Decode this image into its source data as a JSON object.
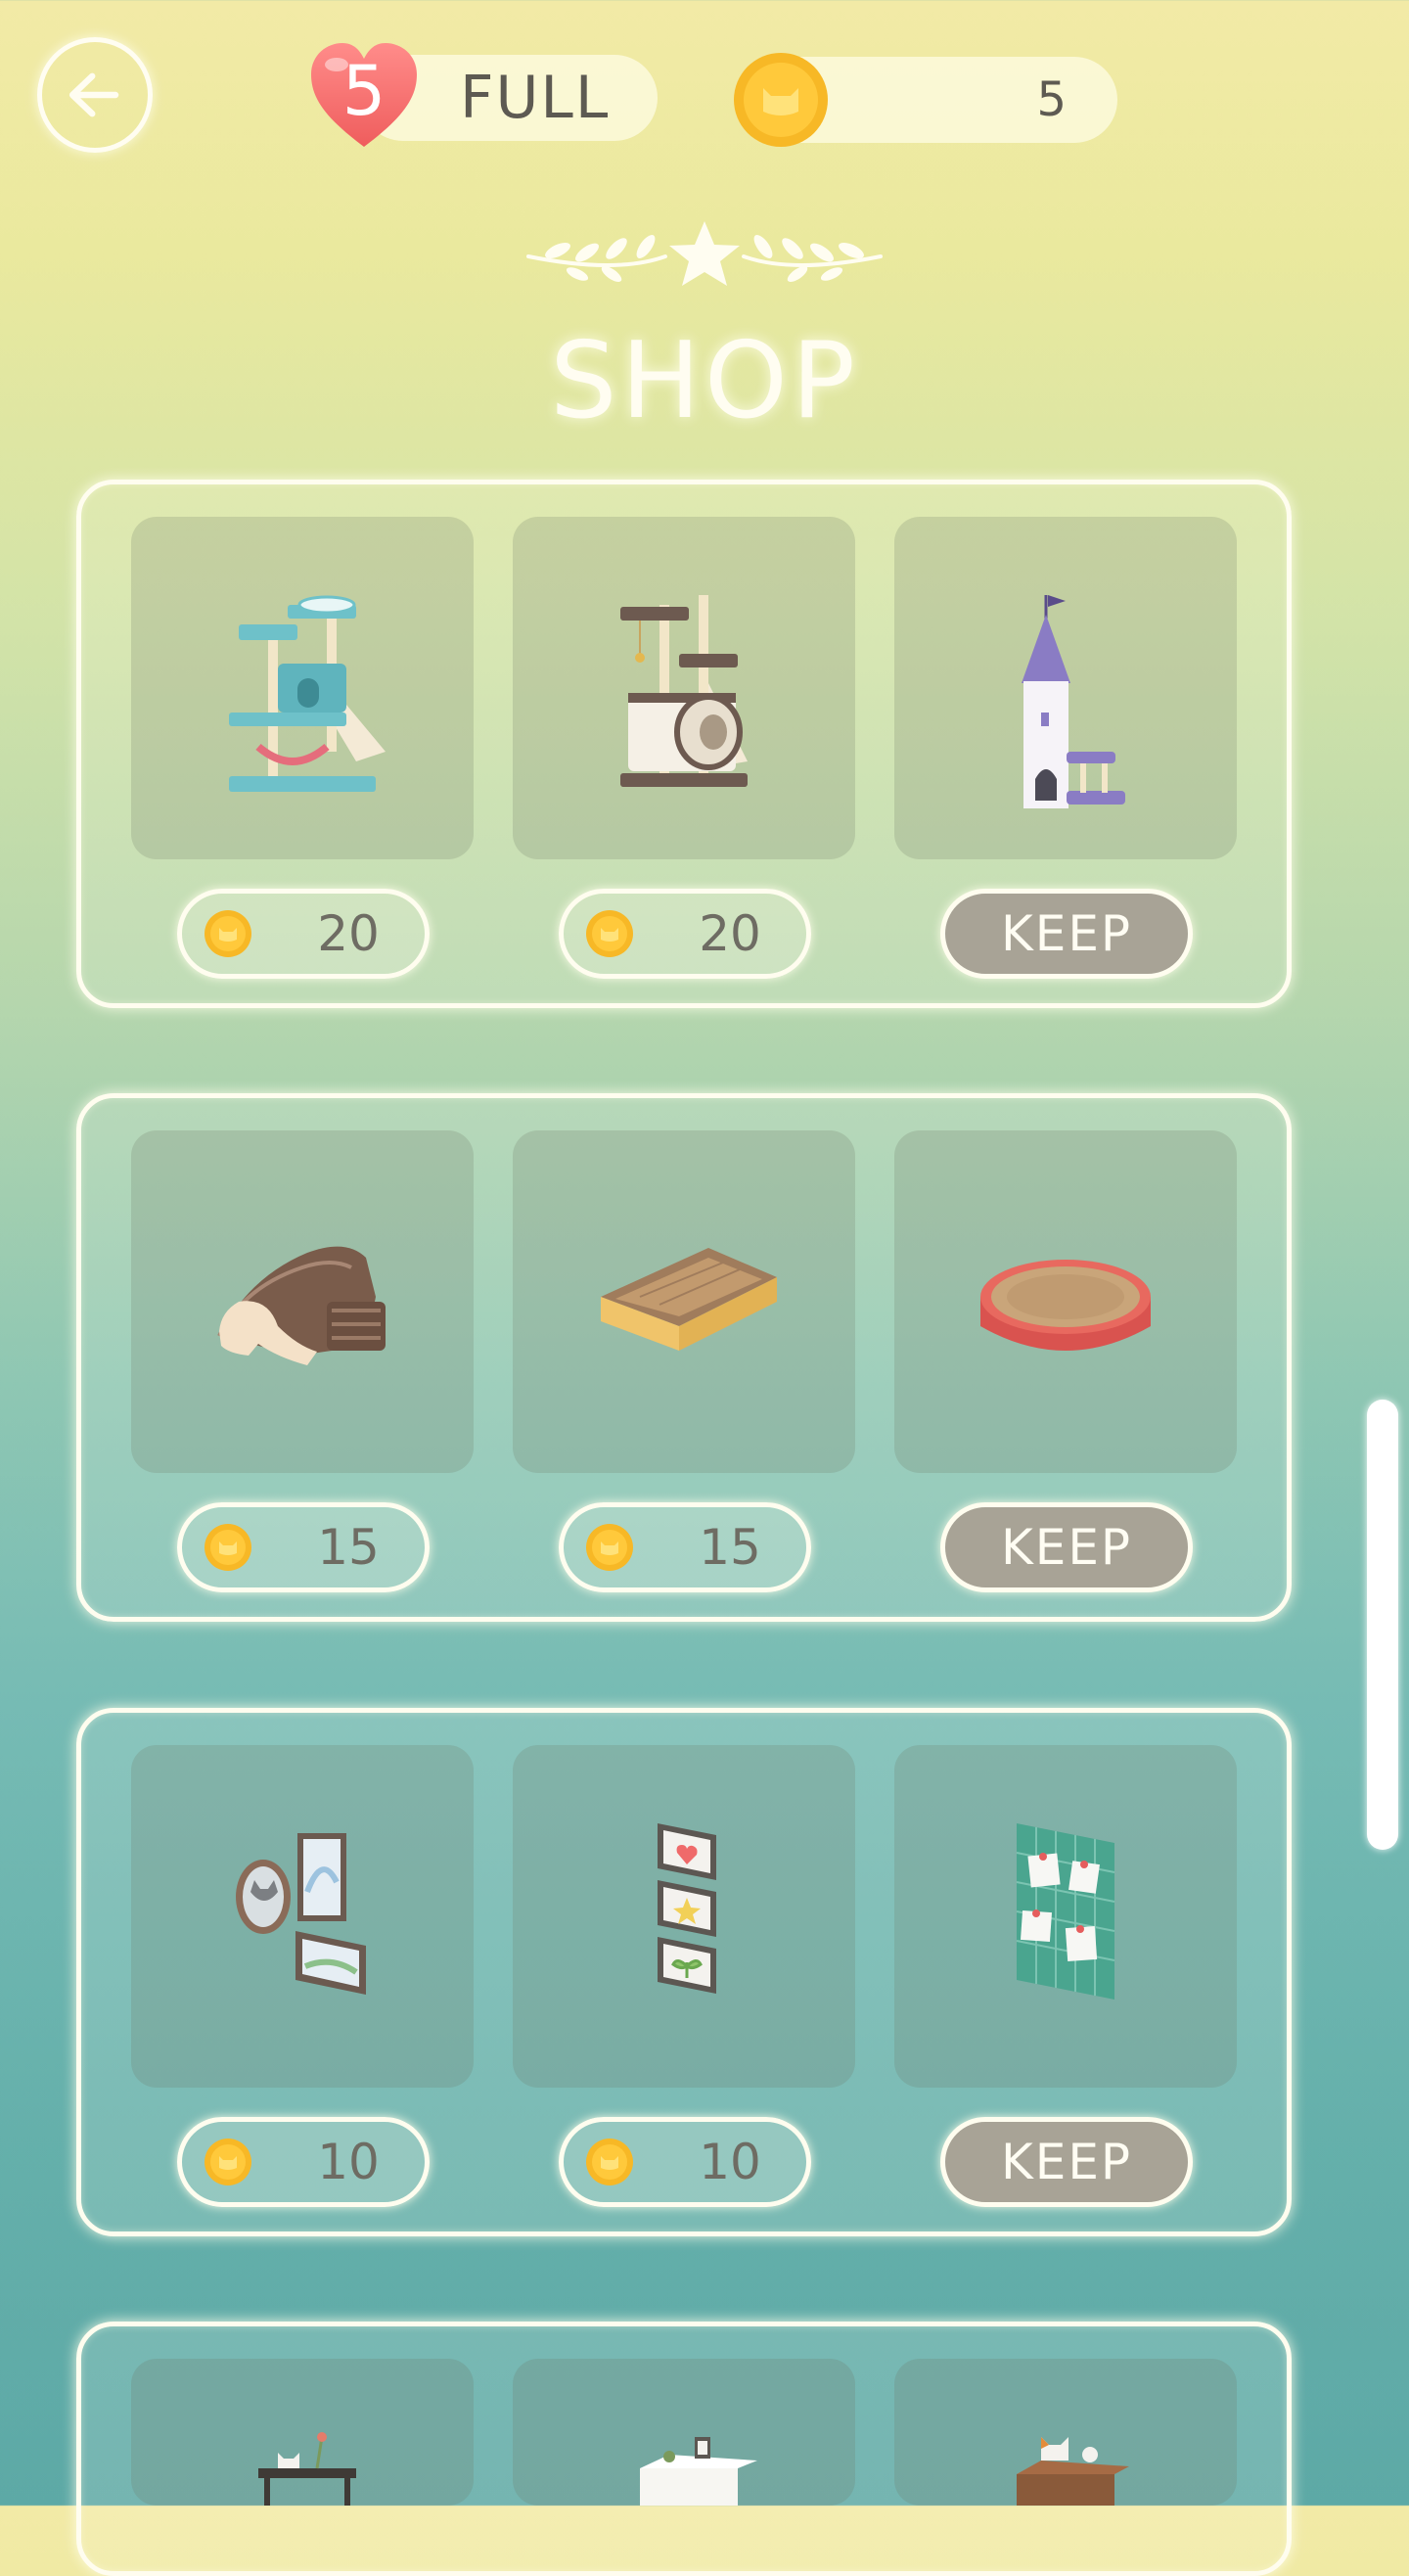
{
  "header": {
    "hearts_count": "5",
    "hearts_status": "FULL",
    "coins": "5"
  },
  "title": "SHOP",
  "colors": {
    "coin": "#f7b826",
    "heart": "#f36a68",
    "keep_bg": "#a8a396"
  },
  "sections": [
    {
      "items": [
        {
          "name": "cat-tree-teal",
          "price": "20"
        },
        {
          "name": "cat-tree-brown",
          "price": "20"
        },
        {
          "name": "cat-castle-tower",
          "action": "KEEP"
        }
      ]
    },
    {
      "items": [
        {
          "name": "cat-scratcher-wave",
          "price": "15"
        },
        {
          "name": "cat-scratcher-box",
          "price": "15"
        },
        {
          "name": "cat-scratcher-round",
          "action": "KEEP"
        }
      ]
    },
    {
      "items": [
        {
          "name": "wall-frames-mirror",
          "price": "10"
        },
        {
          "name": "wall-frames-vertical",
          "price": "10"
        },
        {
          "name": "wall-memo-board",
          "action": "KEEP"
        }
      ]
    },
    {
      "items": [
        {
          "name": "desk-with-cat"
        },
        {
          "name": "white-cabinet"
        },
        {
          "name": "wooden-shelf-with-cat"
        }
      ]
    }
  ]
}
